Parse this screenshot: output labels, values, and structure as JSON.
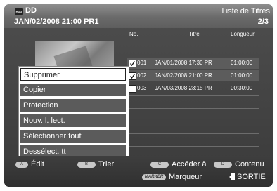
{
  "header": {
    "hdd_label": "HDD",
    "title": "DD",
    "list_label": "Liste de Titres",
    "date_line": "JAN/02/2008 21:00 PR1",
    "page": "2/3"
  },
  "table": {
    "headers": [
      "No.",
      "Titre",
      "Longueur"
    ],
    "rows": [
      {
        "no": "001",
        "title": "JAN/01/2008 17:30 PR",
        "length": "01:00:00",
        "checked": true
      },
      {
        "no": "002",
        "title": "JAN/02/2008 21:00 PR",
        "length": "01:00:00",
        "checked": true
      },
      {
        "no": "003",
        "title": "JAN/03/2008 23:15 PR",
        "length": "00:30:00",
        "checked": false
      }
    ]
  },
  "menu": {
    "items": [
      "Supprimer",
      "Copier",
      "Protection",
      "Nouv. l. lect.",
      "Sélectionner tout",
      "Dessélect. tt"
    ],
    "selected_index": 0
  },
  "footer": {
    "a_key": "A",
    "a_label": "Édit",
    "b_key": "B",
    "b_label": "Trier",
    "c_key": "C",
    "c_label": "Accéder à",
    "d_key": "D",
    "d_label": "Contenu",
    "marker_key": "MARKER",
    "marker_label": "Marqueur",
    "exit_label": "SORTIE"
  }
}
